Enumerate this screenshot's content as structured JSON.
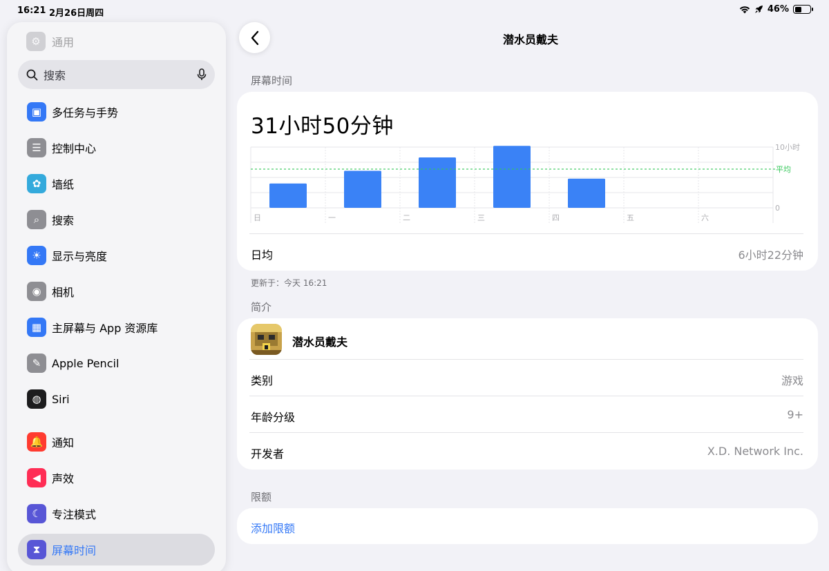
{
  "status": {
    "time": "16:21",
    "date": "2月26日周四",
    "battery_text": "46%",
    "battery_level": 0.46
  },
  "sidebar": {
    "faded_item": {
      "label": "通用",
      "icon": "gear-icon"
    },
    "search": {
      "placeholder": "搜索"
    },
    "items": [
      {
        "label": "多任务与手势",
        "icon": "multitasking-icon",
        "color": "#3478f6",
        "glyph": "▣"
      },
      {
        "label": "控制中心",
        "icon": "toggles-icon",
        "color": "#8e8e93",
        "glyph": "☰"
      },
      {
        "label": "墙纸",
        "icon": "flower-icon",
        "color": "#34aadc",
        "glyph": "✿"
      },
      {
        "label": "搜索",
        "icon": "magnifier-icon",
        "color": "#8e8e93",
        "glyph": "⌕"
      },
      {
        "label": "显示与亮度",
        "icon": "sun-icon",
        "color": "#3478f6",
        "glyph": "☀"
      },
      {
        "label": "相机",
        "icon": "camera-icon",
        "color": "#8e8e93",
        "glyph": "◉"
      },
      {
        "label": "主屏幕与 App 资源库",
        "icon": "home-screen-icon",
        "color": "#3478f6",
        "glyph": "▦"
      },
      {
        "label": "Apple Pencil",
        "icon": "pencil-icon",
        "color": "#8e8e93",
        "glyph": "✎"
      },
      {
        "label": "Siri",
        "icon": "siri-icon",
        "color": "#1c1c1e",
        "glyph": "◍"
      },
      {
        "label": "通知",
        "icon": "bell-icon",
        "color": "#ff3b30",
        "glyph": "🔔"
      },
      {
        "label": "声效",
        "icon": "speaker-icon",
        "color": "#ff2d55",
        "glyph": "◀"
      },
      {
        "label": "专注模式",
        "icon": "moon-icon",
        "color": "#5856d6",
        "glyph": "☾"
      },
      {
        "label": "屏幕时间",
        "icon": "hourglass-icon",
        "color": "#5856d6",
        "glyph": "⧗",
        "active": true
      }
    ]
  },
  "header": {
    "title": "潜水员戴夫"
  },
  "screen_time": {
    "section_label": "屏幕时间",
    "total": "31小时50分钟",
    "daily_avg_label": "日均",
    "daily_avg_value": "6小时22分钟",
    "updated": "更新于：今天 16:21"
  },
  "chart_data": {
    "type": "bar",
    "categories": [
      "日",
      "一",
      "二",
      "三",
      "四",
      "五",
      "六"
    ],
    "values": [
      4.0,
      6.1,
      8.3,
      10.2,
      4.8,
      null,
      null
    ],
    "average": 6.37,
    "ylim": [
      0,
      10
    ],
    "y_ticks": [
      {
        "value": 10,
        "label": "10小时"
      },
      {
        "value": 0,
        "label": "0"
      }
    ],
    "average_label": "平均",
    "bar_color": "#3a82f6",
    "average_color": "#34c759"
  },
  "intro": {
    "section_label": "简介",
    "app_name": "潜水员戴夫",
    "rows": [
      {
        "label": "类别",
        "value": "游戏"
      },
      {
        "label": "年龄分级",
        "value": "9+"
      },
      {
        "label": "开发者",
        "value": "X.D. Network Inc."
      }
    ]
  },
  "limits": {
    "section_label": "限额",
    "add_label": "添加限额"
  }
}
